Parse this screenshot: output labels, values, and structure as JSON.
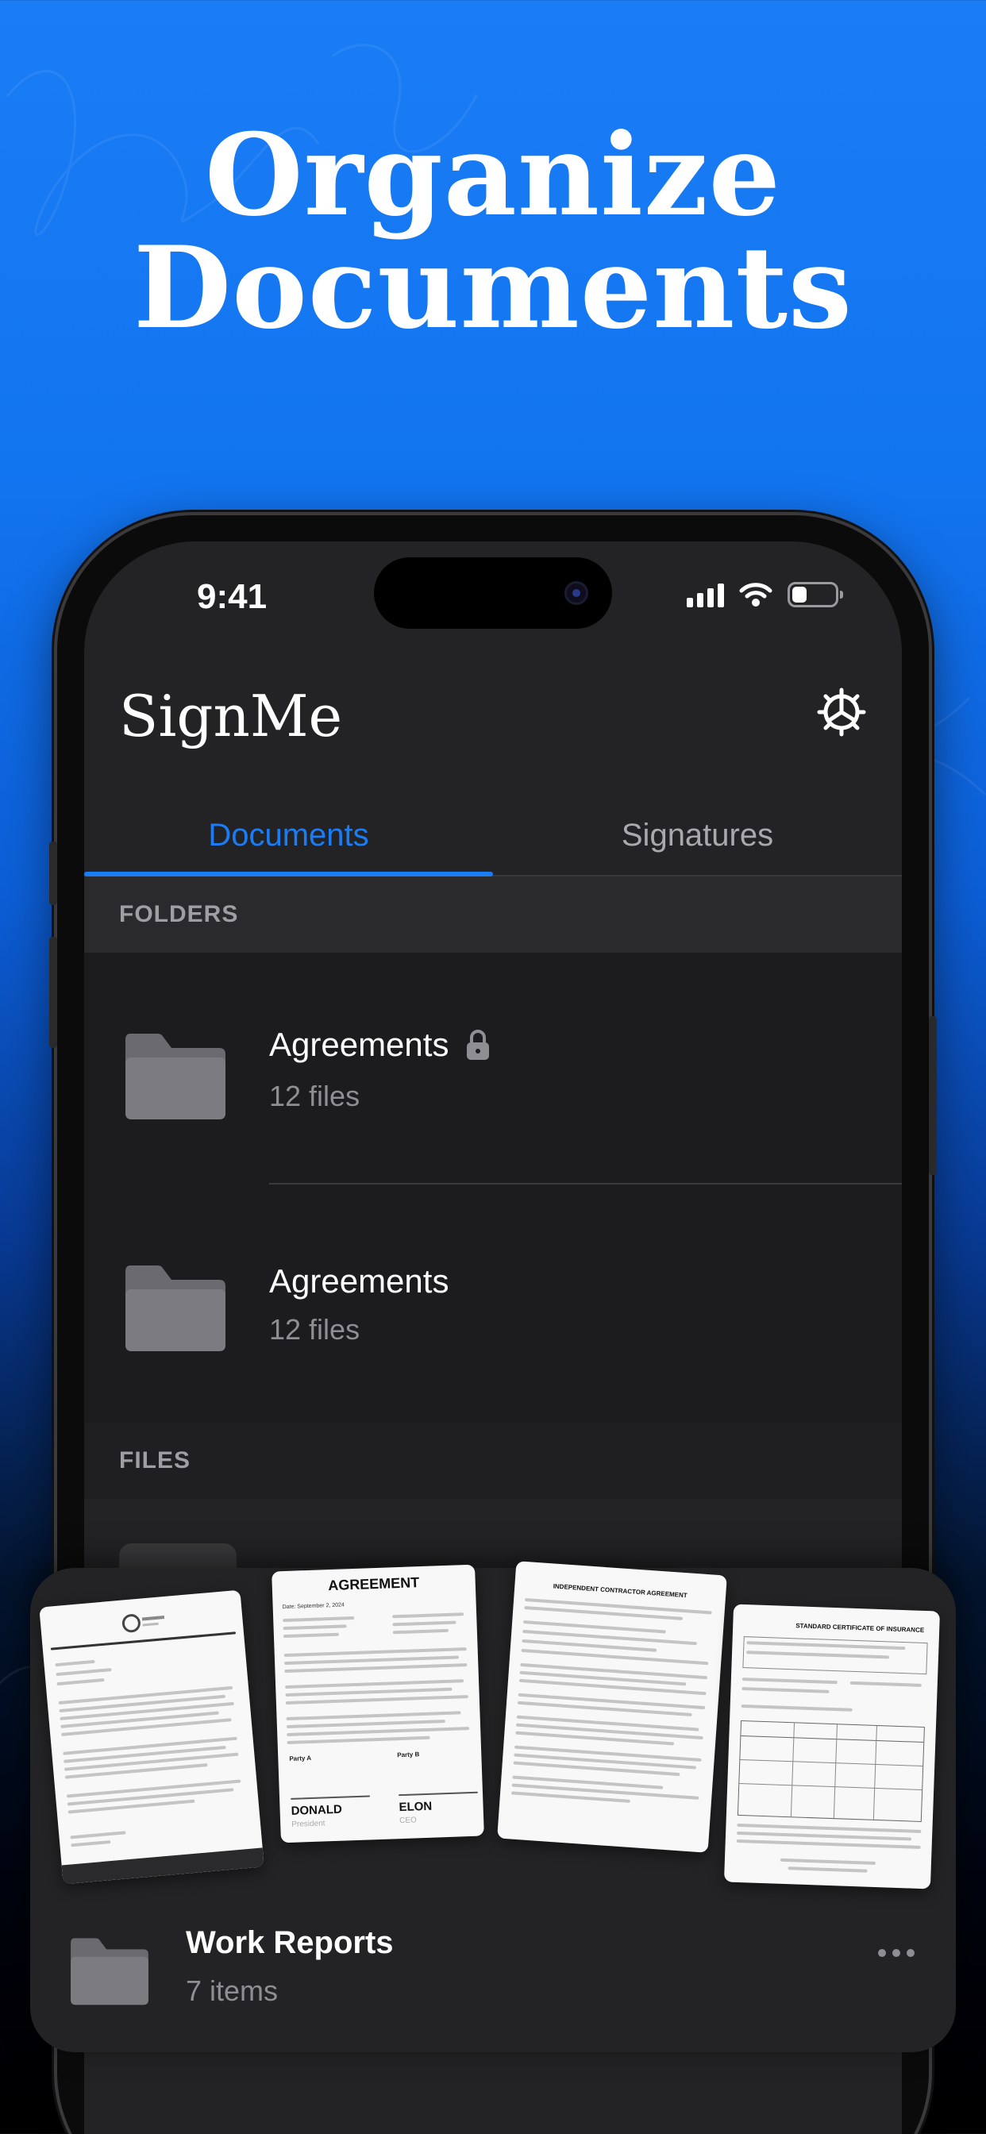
{
  "headline": {
    "line1": "Organize",
    "line2": "Documents"
  },
  "status_bar": {
    "time": "9:41",
    "battery_level": 0.35
  },
  "app": {
    "title": "SignMe"
  },
  "tabs": [
    {
      "label": "Documents",
      "active": true
    },
    {
      "label": "Signatures",
      "active": false
    }
  ],
  "sections": {
    "folders": "FOLDERS",
    "files": "FILES"
  },
  "folders": [
    {
      "name": "Agreements",
      "count": "12 files",
      "locked": true
    },
    {
      "name": "Agreements",
      "count": "12 files",
      "locked": false
    }
  ],
  "card": {
    "title": "Work Reports",
    "subtitle": "7 items",
    "previews": {
      "agreement": {
        "title": "AGREEMENT",
        "date": "Date: September 2, 2024",
        "party_a_label": "Party A",
        "party_b_label": "Party B",
        "signer_a": "DONALD",
        "signer_a_role": "President",
        "signer_b": "ELON",
        "signer_b_role": "CEO"
      },
      "contractor": {
        "title": "INDEPENDENT CONTRACTOR AGREEMENT"
      },
      "insurance": {
        "title": "STANDARD CERTIFICATE OF INSURANCE"
      }
    }
  },
  "colors": {
    "accent": "#1a7df5",
    "background_top": "#1a7df5",
    "screen_bg": "#232325",
    "row_bg": "#1c1c1e",
    "muted_text": "#8e8e93"
  },
  "icons": {
    "settings": "gear-icon",
    "folder": "folder-icon",
    "lock": "lock-icon",
    "more": "more-icon",
    "signal": "signal-icon",
    "wifi": "wifi-icon",
    "battery": "battery-icon"
  }
}
